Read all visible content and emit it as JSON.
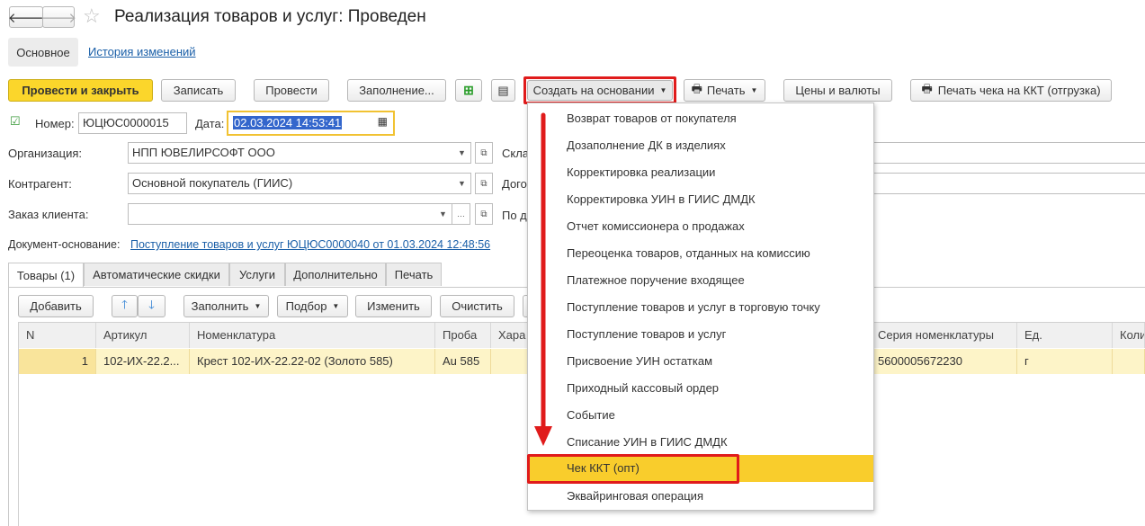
{
  "window": {
    "title": "Реализация товаров и услуг: Проведен",
    "tabs": [
      "Основное",
      "История изменений"
    ]
  },
  "toolbar": {
    "post_close": "Провести и закрыть",
    "save": "Записать",
    "post": "Провести",
    "fill": "Заполнение...",
    "create_based": "Создать на основании",
    "print": "Печать",
    "prices": "Цены и валюты",
    "print_check": "Печать чека на ККТ (отгрузка)"
  },
  "header": {
    "number_label": "Номер:",
    "number_value": "ЮЦЮС0000015",
    "date_label": "Дата:",
    "date_value": "02.03.2024 14:53:41",
    "org_label": "Организация:",
    "org_value": "НПП ЮВЕЛИРСОФТ ООО",
    "contractor_label": "Контрагент:",
    "contractor_value": "Основной покупатель (ГИИС)",
    "order_label": "Заказ клиента:",
    "order_value": "",
    "right_label1": "Скла",
    "right_label2": "Дого",
    "right_label3": "По д",
    "base_doc_label": "Документ-основание:",
    "base_doc_value": "Поступление товаров и услуг ЮЦЮС0000040 от 01.03.2024 12:48:56"
  },
  "doc_tabs": [
    "Товары (1)",
    "Автоматические скидки",
    "Услуги",
    "Дополнительно",
    "Печать"
  ],
  "table_toolbar": {
    "add": "Добавить",
    "fill": "Заполнить",
    "select": "Подбор",
    "change": "Изменить",
    "clear": "Очистить"
  },
  "table": {
    "columns": [
      "N",
      "Артикул",
      "Номенклатура",
      "Проба",
      "Хара",
      "Серия номенклатуры",
      "Ед.",
      "Коли"
    ],
    "rows": [
      {
        "n": "1",
        "article": "102-ИХ-22.2...",
        "item": "Крест 102-ИХ-22.22-02 (Золото 585)",
        "probe": "Au 585",
        "char": "",
        "series": "5600005672230",
        "unit": "г",
        "qty": ""
      }
    ]
  },
  "dropdown": {
    "items": [
      "Возврат товаров от покупателя",
      "Дозаполнение ДК в изделиях",
      "Корректировка реализации",
      "Корректировка УИН в ГИИС ДМДК",
      "Отчет комиссионера о продажах",
      "Переоценка товаров, отданных на комиссию",
      "Платежное поручение входящее",
      "Поступление товаров и услуг в торговую точку",
      "Поступление товаров и услуг",
      "Присвоение УИН остаткам",
      "Приходный кассовый ордер",
      "Событие",
      "Списание УИН в ГИИС ДМДК",
      "Чек ККТ (опт)",
      "Эквайринговая операция"
    ],
    "highlighted_index": 13
  },
  "colors": {
    "accent_yellow": "#fbd62b",
    "highlight_red": "#e01b1b",
    "link_blue": "#1a5fa8",
    "row_selected": "#fdf4c8"
  }
}
